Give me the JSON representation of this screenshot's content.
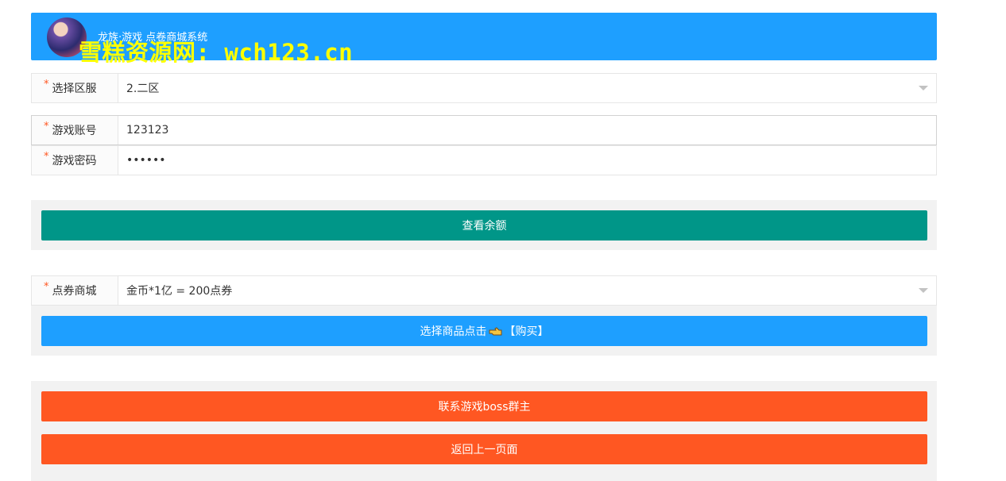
{
  "header": {
    "title": "龙族·游戏 点卷商城系统",
    "watermark": "雪糕资源网: wch123.cn"
  },
  "form": {
    "server": {
      "label": "选择区服",
      "value": "2.二区"
    },
    "account": {
      "label": "游戏账号",
      "value": "123123"
    },
    "password": {
      "label": "游戏密码",
      "value": "••••••"
    },
    "check_balance_button": "查看余额",
    "shop": {
      "label": "点券商城",
      "value": "金币*1亿 = 200点券"
    },
    "buy_button": {
      "prefix": "选择商品点击",
      "suffix": "【购买】"
    },
    "contact_button": "联系游戏boss群主",
    "back_button": "返回上一页面"
  },
  "colors": {
    "header": "#1e9fff",
    "green": "#009688",
    "blue": "#1e9fff",
    "orange": "#ff5722",
    "watermark": "#ffff00"
  }
}
